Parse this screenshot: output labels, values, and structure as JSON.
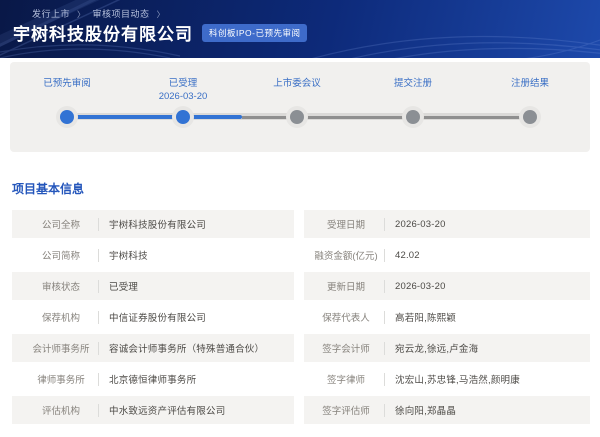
{
  "header": {
    "breadcrumb": {
      "item1": "发行上市",
      "item2": "审核项目动态",
      "separator": "〉"
    },
    "company_title": "宇树科技股份有限公司",
    "badge": "科创板IPO-已预先审阅"
  },
  "stepper": {
    "steps": [
      {
        "label": "已预先审阅",
        "date": "",
        "state": "done"
      },
      {
        "label": "已受理",
        "date": "2026-03-20",
        "state": "done"
      },
      {
        "label": "上市委会议",
        "date": "",
        "state": "pending"
      },
      {
        "label": "提交注册",
        "date": "",
        "state": "pending"
      },
      {
        "label": "注册结果",
        "date": "",
        "state": "pending"
      }
    ]
  },
  "section": {
    "title": "项目基本信息"
  },
  "info_table": {
    "rows": [
      {
        "left": {
          "label": "公司全称",
          "value": "宇树科技股份有限公司"
        },
        "right": {
          "label": "受理日期",
          "value": "2026-03-20"
        }
      },
      {
        "left": {
          "label": "公司简称",
          "value": "宇树科技"
        },
        "right": {
          "label": "融资金额(亿元)",
          "value": "42.02"
        }
      },
      {
        "left": {
          "label": "审核状态",
          "value": "已受理"
        },
        "right": {
          "label": "更新日期",
          "value": "2026-03-20"
        }
      },
      {
        "left": {
          "label": "保荐机构",
          "value": "中信证券股份有限公司"
        },
        "right": {
          "label": "保荐代表人",
          "value": "高若阳,陈熙颖"
        }
      },
      {
        "left": {
          "label": "会计师事务所",
          "value": "容诚会计师事务所（特殊普通合伙）"
        },
        "right": {
          "label": "签字会计师",
          "value": "宛云龙,徐远,卢金海"
        }
      },
      {
        "left": {
          "label": "律师事务所",
          "value": "北京德恒律师事务所"
        },
        "right": {
          "label": "签字律师",
          "value": "沈宏山,苏忠锋,马浩然,颜明康"
        }
      },
      {
        "left": {
          "label": "评估机构",
          "value": "中水致远资产评估有限公司"
        },
        "right": {
          "label": "签字评估师",
          "value": "徐向阳,郑晶晶"
        }
      }
    ]
  },
  "colors": {
    "accent_blue": "#3273d4",
    "header_navy": "#0d2a7a",
    "badge_blue": "#3e6bca",
    "section_title_blue": "#2456bb",
    "pending_dot_gray": "#8b8f94",
    "row_background": "#f4f3f1"
  }
}
